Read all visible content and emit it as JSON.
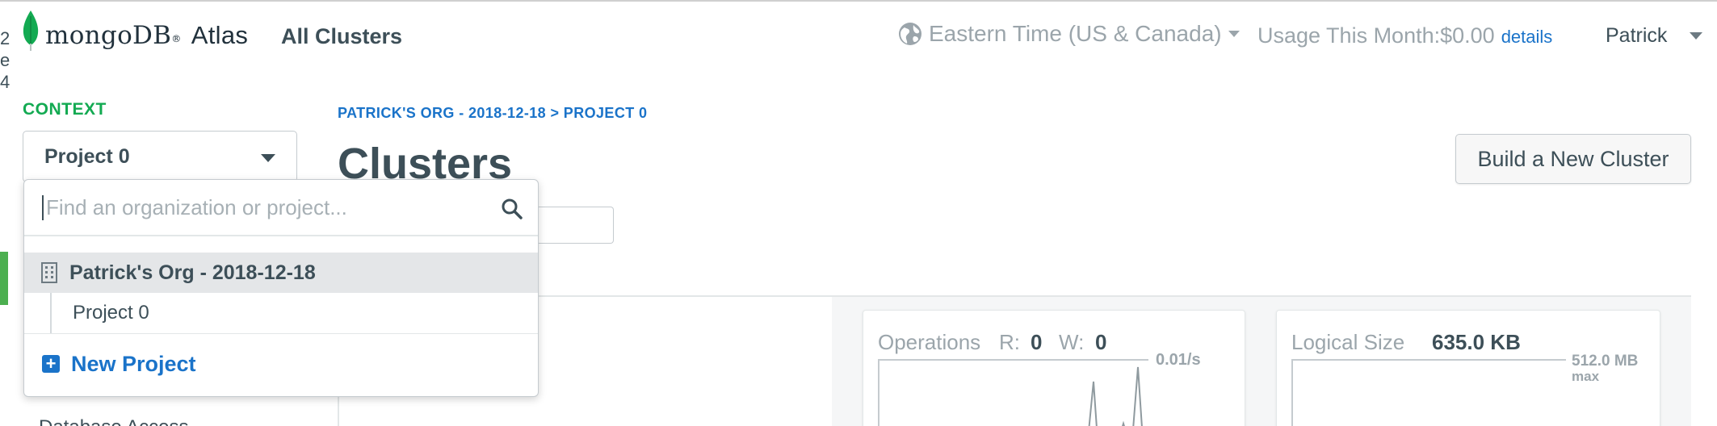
{
  "header": {
    "logo_text": "mongoDB",
    "logo_reg": "®",
    "logo_suffix": "Atlas",
    "all_clusters": "All Clusters",
    "timezone": "Eastern Time (US & Canada)",
    "usage_label": "Usage This Month:$0.00",
    "details_link": "details",
    "user": "Patrick"
  },
  "left_edge_letters": [
    "2",
    "e",
    "4"
  ],
  "sidebar": {
    "context_label": "CONTEXT",
    "project_select_value": "Project 0",
    "bottom_item": "Database Access"
  },
  "dropdown": {
    "search_placeholder": "Find an organization or project...",
    "org_name": "Patrick's Org - 2018-12-18",
    "project_name": "Project 0",
    "new_project": "New Project"
  },
  "main": {
    "breadcrumb": "PATRICK'S ORG - 2018-12-18 > PROJECT 0",
    "title": "Clusters",
    "build_button": "Build a New Cluster"
  },
  "metrics": {
    "operations": {
      "label": "Operations",
      "r_label": "R:",
      "r_value": "0",
      "w_label": "W:",
      "w_value": "0",
      "rate": "0.01/s"
    },
    "logical_size": {
      "label": "Logical Size",
      "value": "635.0 KB",
      "max_value": "512.0 MB",
      "max_label": "max"
    }
  },
  "colors": {
    "brand_green": "#13aa52",
    "link_blue": "#1a73c9",
    "text_dark": "#3d4f58",
    "text_muted": "#9ba5ab"
  }
}
